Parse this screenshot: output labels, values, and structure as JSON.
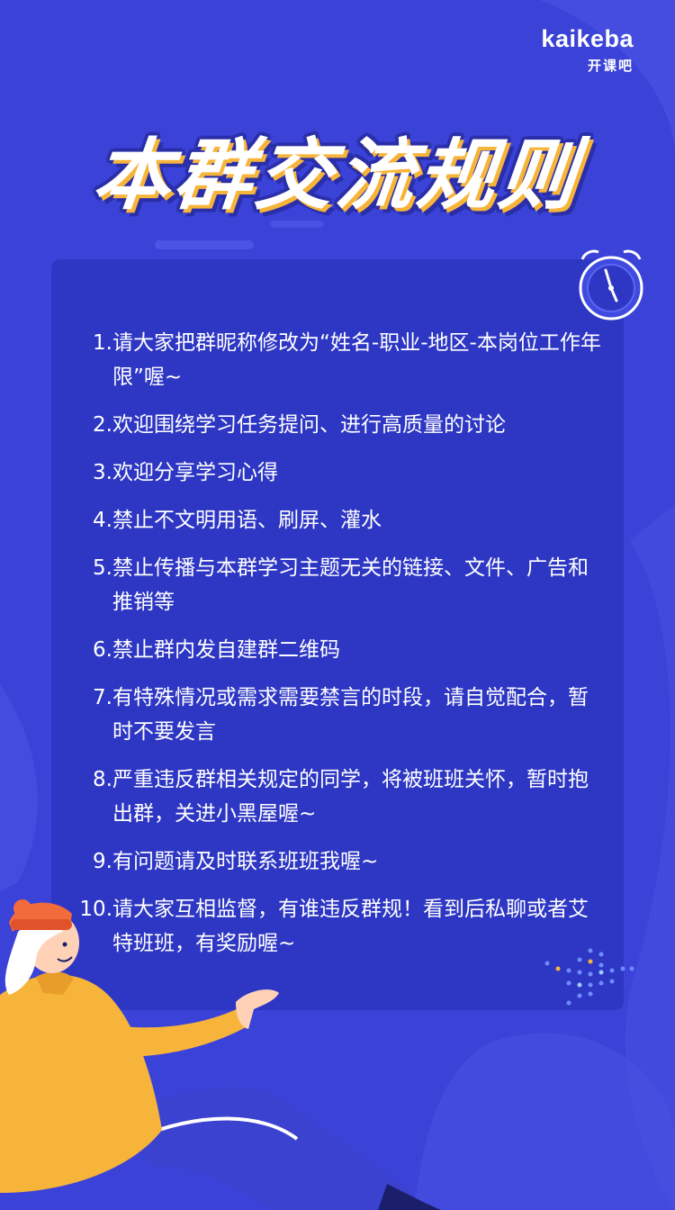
{
  "brand": {
    "logo_text": "kaikeba",
    "logo_sub": "开课吧"
  },
  "title": "本群交流规则",
  "rules": [
    {
      "num": "1.",
      "text": "请大家把群昵称修改为“姓名-职业-地区-本岗位工作年限”喔~"
    },
    {
      "num": "2.",
      "text": "欢迎围绕学习任务提问、进行高质量的讨论"
    },
    {
      "num": "3.",
      "text": "欢迎分享学习心得"
    },
    {
      "num": "4.",
      "text": "禁止不文明用语、刷屏、灌水"
    },
    {
      "num": "5.",
      "text": "禁止传播与本群学习主题无关的链接、文件、广告和推销等"
    },
    {
      "num": "6.",
      "text": "禁止群内发自建群二维码"
    },
    {
      "num": "7.",
      "text": "有特殊情况或需求需要禁言的时段，请自觉配合，暂时不要发言"
    },
    {
      "num": "8.",
      "text": "严重违反群相关规定的同学，将被班班关怀，暂时抱出群，关进小黑屋喔~"
    },
    {
      "num": "9.",
      "text": "有问题请及时联系班班我喔~"
    },
    {
      "num": "10.",
      "text": "请大家互相监督，有谁违反群规！看到后私聊或者艾特班班，有奖励喔~"
    }
  ],
  "colors": {
    "background": "#3a42d8",
    "panel": "#2e37c4",
    "title_accent": "#f7b43a",
    "text": "#ffffff"
  },
  "icons": [
    "alarm-clock-icon",
    "dot-grid-decoration",
    "person-illustration"
  ]
}
